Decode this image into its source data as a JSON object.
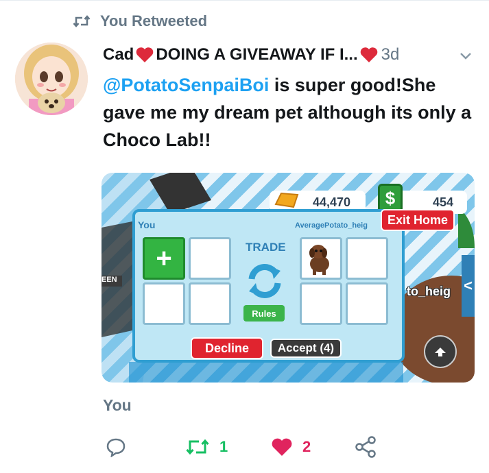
{
  "retweet_context": {
    "label": "You Retweeted"
  },
  "tweet": {
    "author_name_start": "Cad",
    "author_name_middle": "DOING A GIVEAWAY IF I...",
    "author_tail": "",
    "time_ago": "3d",
    "mention": "@PotatoSenpaiBoi",
    "text_after_mention": " is super good!She gave me my dream pet although its only a Choco Lab!!"
  },
  "game": {
    "bucks": "44,470",
    "dollars": "454",
    "exit_button": "Exit Home",
    "you_label": "You",
    "other_label": "AveragePotato_heig",
    "trade_label": "TRADE",
    "rules_button": "Rules",
    "decline_button": "Decline",
    "accept_button": "Accept (4)",
    "side_label": "EEN",
    "name_tag": "to_heig",
    "add_symbol": "+",
    "cash_symbol": "$",
    "chevron": "<"
  },
  "footer": {
    "you_label": "You",
    "retweet_count": "1",
    "like_count": "2"
  },
  "colors": {
    "accent_blue": "#1da1f2",
    "retweet_green": "#17bf63",
    "like_red": "#e0245e",
    "muted_gray": "#657786"
  },
  "icons": [
    "retweet-icon",
    "chevron-down-icon",
    "reply-icon",
    "heart-icon",
    "share-icon",
    "refresh-icon"
  ]
}
